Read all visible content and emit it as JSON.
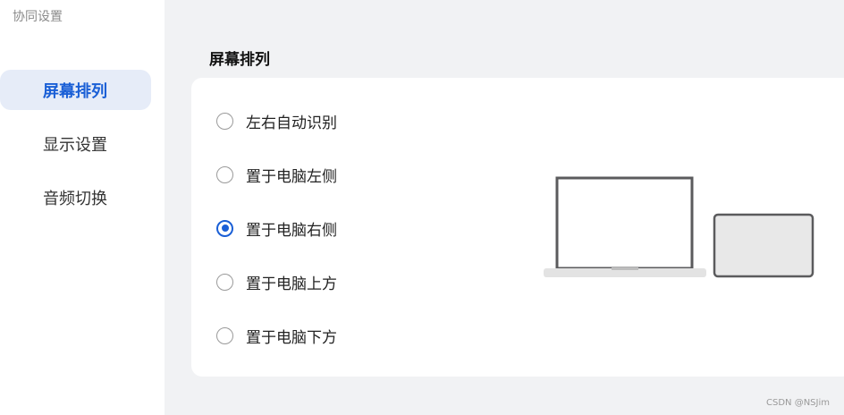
{
  "sidebar": {
    "title": "协同设置",
    "items": [
      {
        "label": "屏幕排列",
        "active": true
      },
      {
        "label": "显示设置",
        "active": false
      },
      {
        "label": "音频切换",
        "active": false
      }
    ]
  },
  "main": {
    "section_title": "屏幕排列",
    "options": [
      {
        "label": "左右自动识别",
        "selected": false
      },
      {
        "label": "置于电脑左侧",
        "selected": false
      },
      {
        "label": "置于电脑右侧",
        "selected": true
      },
      {
        "label": "置于电脑上方",
        "selected": false
      },
      {
        "label": "置于电脑下方",
        "selected": false
      }
    ],
    "illustration": {
      "laptop_icon": "laptop-icon",
      "tablet_icon": "tablet-icon"
    }
  },
  "watermark": "CSDN @NSJim",
  "colors": {
    "accent": "#1a5fd6",
    "active_bg": "#e6ecf8",
    "page_bg": "#f1f2f4"
  }
}
